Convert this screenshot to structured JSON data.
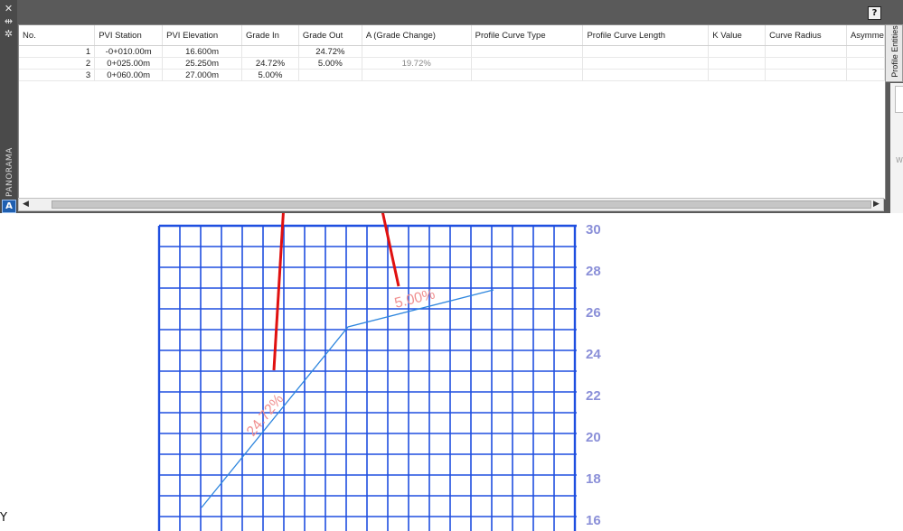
{
  "window": {
    "side_title": "PANORAMA",
    "help_label": "?",
    "right_tab_label": "Profile Entities",
    "right_stub_text": "W"
  },
  "table": {
    "columns": [
      "No.",
      "PVI Station",
      "PVI Elevation",
      "Grade In",
      "Grade Out",
      "A (Grade Change)",
      "Profile Curve Type",
      "Profile Curve Length",
      "K Value",
      "Curve Radius",
      "Asymme"
    ],
    "rows": [
      {
        "no": "1",
        "station": "-0+010.00m",
        "elevation": "16.600m",
        "grade_in": "",
        "grade_out": "24.72%",
        "a": "",
        "type": "",
        "length": "",
        "k": "",
        "radius": "",
        "asym": ""
      },
      {
        "no": "2",
        "station": "0+025.00m",
        "elevation": "25.250m",
        "grade_in": "24.72%",
        "grade_out": "5.00%",
        "a": "19.72%",
        "type": "",
        "length": "",
        "k": "",
        "radius": "",
        "asym": ""
      },
      {
        "no": "3",
        "station": "0+060.00m",
        "elevation": "27.000m",
        "grade_in": "5.00%",
        "grade_out": "",
        "a": "",
        "type": "",
        "length": "",
        "k": "",
        "radius": "",
        "asym": ""
      }
    ]
  },
  "drawing": {
    "y_ticks": [
      "30",
      "28",
      "26",
      "24",
      "22",
      "20",
      "18",
      "16"
    ],
    "grade_label_1": "24.72%",
    "grade_label_2": "5.00%",
    "ucs_label": "Y",
    "colors": {
      "grid": "#1f4fe0",
      "ticks": "#8a8fd8",
      "profile": "#2e86de",
      "labels": "#f09090",
      "arrows": "#e01010"
    }
  }
}
